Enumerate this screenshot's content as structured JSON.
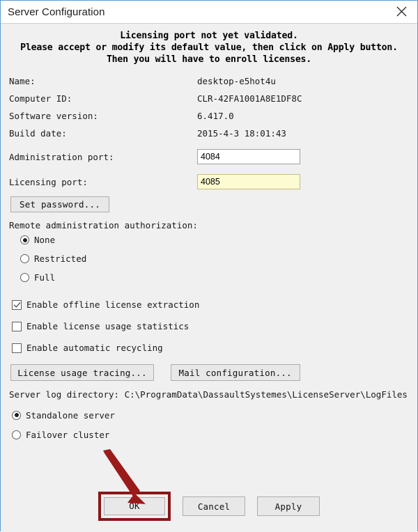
{
  "window": {
    "title": "Server Configuration",
    "close_icon": "close-icon",
    "border_color": "#5b9bd1"
  },
  "banner": {
    "line1": "Licensing port not yet validated.",
    "line2": "Please accept or modify its default value, then click on Apply button.",
    "line3": "Then you will have to enroll licenses."
  },
  "info": [
    {
      "label": "Name:",
      "value": "desktop-e5hot4u"
    },
    {
      "label": "Computer ID:",
      "value": "CLR-42FA1001A8E1DF8C"
    },
    {
      "label": "Software version:",
      "value": "6.417.0"
    },
    {
      "label": "Build date:",
      "value": "2015-4-3 18:01:43"
    }
  ],
  "ports": {
    "admin_label": "Administration port:",
    "admin_value": "4084",
    "licensing_label": "Licensing port:",
    "licensing_value": "4085",
    "licensing_highlight_color": "#fdfbd2"
  },
  "buttons": {
    "set_password": "Set password...",
    "license_usage_tracing": "License usage tracing...",
    "mail_configuration": "Mail configuration..."
  },
  "remote_admin": {
    "label": "Remote administration authorization:",
    "options": [
      {
        "label": "None",
        "selected": true
      },
      {
        "label": "Restricted",
        "selected": false
      },
      {
        "label": "Full",
        "selected": false
      }
    ]
  },
  "checkboxes": [
    {
      "label": "Enable offline license extraction",
      "checked": true
    },
    {
      "label": "Enable license usage statistics",
      "checked": false
    },
    {
      "label": "Enable automatic recycling",
      "checked": false
    }
  ],
  "log_directory": {
    "label": "Server log directory:",
    "path": "C:\\ProgramData\\DassaultSystemes\\LicenseServer\\LogFiles"
  },
  "server_mode": {
    "options": [
      {
        "label": "Standalone server",
        "selected": true
      },
      {
        "label": "Failover cluster",
        "selected": false
      }
    ]
  },
  "footer": {
    "ok": "OK",
    "cancel": "Cancel",
    "apply": "Apply"
  },
  "annotation": {
    "highlight_color": "#8a1718",
    "arrow_color": "#9b1b1b",
    "target": "ok-button"
  }
}
